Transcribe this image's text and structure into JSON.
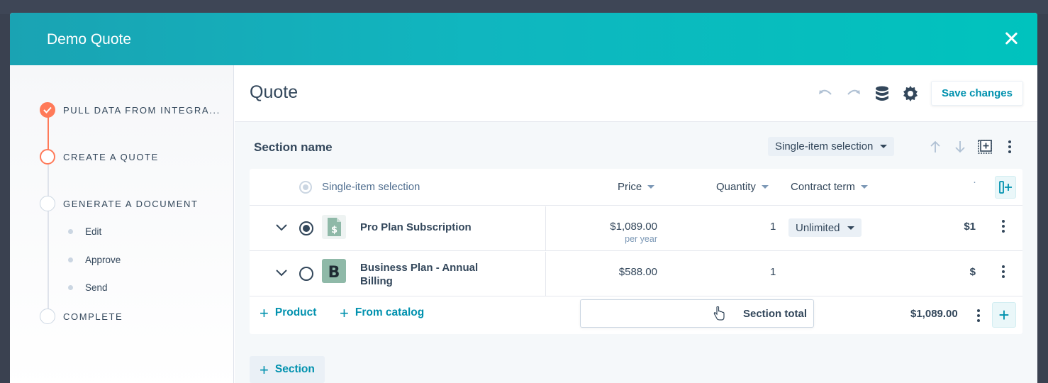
{
  "modal": {
    "title": "Demo Quote"
  },
  "steps": [
    {
      "label": "PULL DATA FROM INTEGRA...",
      "state": "done"
    },
    {
      "label": "CREATE A QUOTE",
      "state": "current"
    },
    {
      "label": "GENERATE A DOCUMENT",
      "state": "pending"
    },
    {
      "label": "COMPLETE",
      "state": "pending"
    }
  ],
  "substeps": [
    "Edit",
    "Approve",
    "Send"
  ],
  "main": {
    "title": "Quote",
    "save_label": "Save changes"
  },
  "section": {
    "name": "Section name",
    "selection_mode": "Single-item selection"
  },
  "table": {
    "select_label": "Single-item selection",
    "columns": {
      "price": "Price",
      "quantity": "Quantity",
      "term": "Contract term",
      "amount": "·"
    },
    "rows": [
      {
        "name": "Pro Plan Subscription",
        "price": "$1,089.00",
        "price_sub": "per year",
        "quantity": "1",
        "term": "Unlimited",
        "amount": "$1",
        "selected": true,
        "icon": "dollar-document-icon"
      },
      {
        "name": "Business Plan - Annual Billing",
        "price": "$588.00",
        "price_sub": "",
        "quantity": "1",
        "term": "",
        "amount": "$",
        "selected": false,
        "icon": "business-b-icon"
      }
    ],
    "footer": {
      "add_product": "Product",
      "from_catalog": "From catalog",
      "section_total_label": "Section total",
      "section_total": "$1,089.00"
    }
  },
  "add_section_label": "Section",
  "colors": {
    "header_start": "#1aa3b3",
    "header_end": "#00c3be",
    "accent": "#ff7a59",
    "link": "#0091ae"
  }
}
